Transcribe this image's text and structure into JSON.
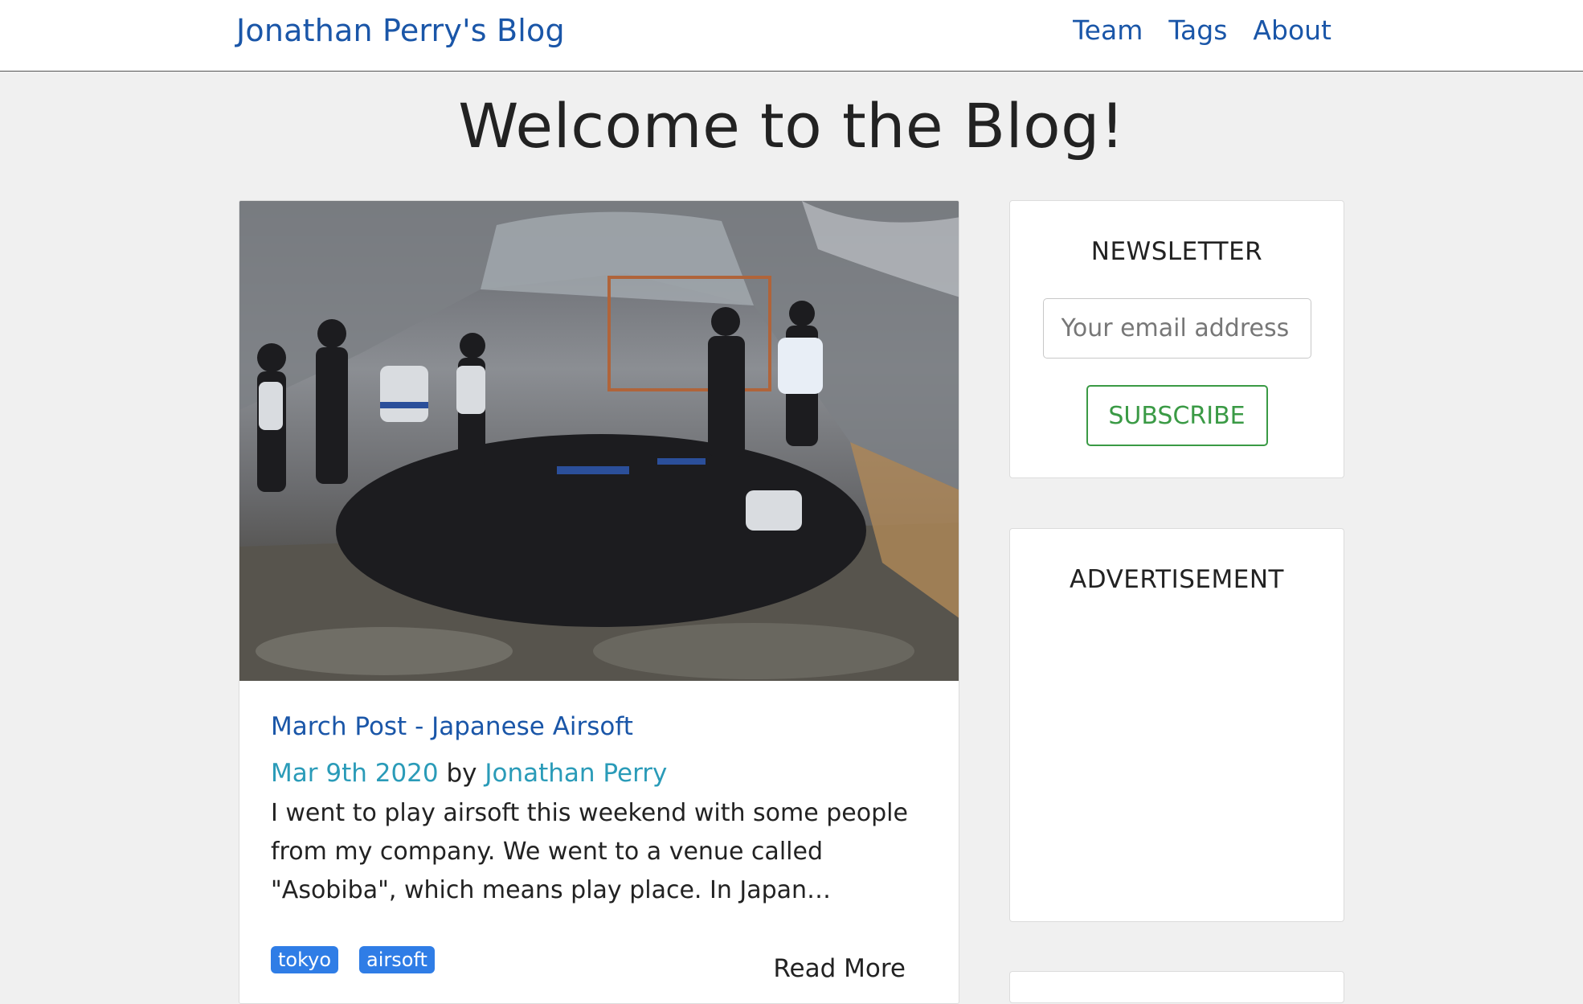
{
  "header": {
    "brand": "Jonathan Perry's Blog",
    "nav": [
      "Team",
      "Tags",
      "About"
    ]
  },
  "page": {
    "title": "Welcome to the Blog!"
  },
  "post": {
    "image_alt": "group photo of airsoft players in masks at an indoor venue",
    "title": "March Post - Japanese Airsoft",
    "date": "Mar 9th 2020",
    "by": "by",
    "author": "Jonathan Perry",
    "excerpt": "I went to play airsoft this weekend with some people from my company. We went to a venue called \"Asobiba\", which means play place. In Japan…",
    "tags": [
      "tokyo",
      "airsoft"
    ],
    "read_more": "Read More"
  },
  "sidebar": {
    "newsletter": {
      "heading": "NEWSLETTER",
      "placeholder": "Your email address",
      "button": "SUBSCRIBE"
    },
    "advertisement": {
      "heading": "ADVERTISEMENT"
    }
  },
  "colors": {
    "link": "#1a56a8",
    "meta_link": "#2a9bb8",
    "tag": "#2f7de6",
    "subscribe": "#3a9a45",
    "background": "#f0f0f0"
  }
}
